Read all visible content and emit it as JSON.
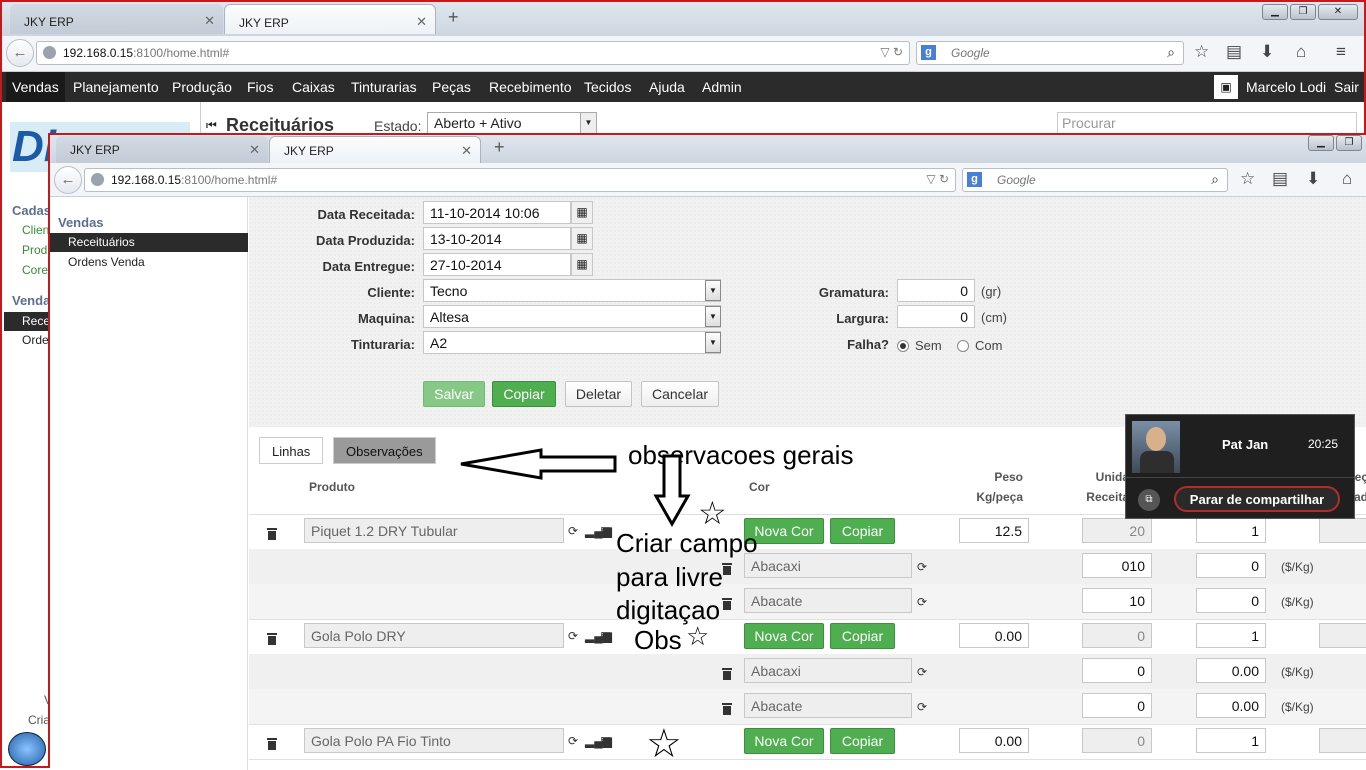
{
  "back_window": {
    "tabs": [
      {
        "title": "JKY ERP"
      },
      {
        "title": "JKY ERP"
      }
    ],
    "url_host": "192.168.0.15",
    "url_rest": ":8100/home.html#",
    "search_placeholder": "Google",
    "menu": [
      "Vendas",
      "Planejamento",
      "Produção",
      "Fios",
      "Caixas",
      "Tinturarias",
      "Peças",
      "Recebimento",
      "Tecidos",
      "Ajuda",
      "Admin"
    ],
    "user": "Marcelo Lodi",
    "logout": "Sair",
    "page_title": "Receituários",
    "estado_label": "Estado:",
    "estado_value": "Aberto + Ativo",
    "search_box_placeholder": "Procurar",
    "logo_text": "Di",
    "sidebar_partial": [
      "Cadas",
      "Clien",
      "Prod",
      "Core",
      "Venda",
      "Rece",
      "Orde",
      "V",
      "Cria"
    ]
  },
  "front_window": {
    "tabs": [
      {
        "title": "JKY ERP"
      },
      {
        "title": "JKY ERP"
      }
    ],
    "url_host": "192.168.0.15",
    "url_rest": ":8100/home.html#",
    "search_placeholder": "Google",
    "sidebar": {
      "section": "Vendas",
      "items": [
        {
          "label": "Receituários",
          "active": true
        },
        {
          "label": "Ordens Venda",
          "active": false
        }
      ]
    },
    "form": {
      "data_receitada": {
        "label": "Data Receitada:",
        "value": "11-10-2014 10:06"
      },
      "data_produzida": {
        "label": "Data Produzida:",
        "value": "13-10-2014"
      },
      "data_entregue": {
        "label": "Data Entregue:",
        "value": "27-10-2014"
      },
      "cliente": {
        "label": "Cliente:",
        "value": "Tecno"
      },
      "maquina": {
        "label": "Maquina:",
        "value": "Altesa"
      },
      "tinturaria": {
        "label": "Tinturaria:",
        "value": "A2"
      },
      "gramatura": {
        "label": "Gramatura:",
        "value": "0",
        "unit": "(gr)"
      },
      "largura": {
        "label": "Largura:",
        "value": "0",
        "unit": "(cm)"
      },
      "falha": {
        "label": "Falha?",
        "options": [
          "Sem",
          "Com"
        ],
        "selected": "Sem"
      }
    },
    "buttons": {
      "salvar": "Salvar",
      "copiar": "Copiar",
      "deletar": "Deletar",
      "cancelar": "Cancelar"
    },
    "tabs_inner": {
      "linhas": "Linhas",
      "observacoes": "Observações"
    },
    "columns": {
      "produto": "Produto",
      "cor": "Cor",
      "peso_1": "Peso",
      "peso_2": "Kg/peça",
      "unid_1": "Unida",
      "unid_2": "Receita",
      "extra_1": "eç",
      "extra_2": "ad"
    },
    "row_buttons": {
      "nova_cor": "Nova Cor",
      "copiar": "Copiar"
    },
    "per_kg": "($/Kg)",
    "products": [
      {
        "name": "Piquet 1.2 DRY Tubular",
        "peso": "12.5",
        "unid": "20",
        "qty": "1",
        "colors": [
          {
            "name": "Abacaxi",
            "a": "010",
            "b": "0"
          },
          {
            "name": "Abacate",
            "a": "10",
            "b": "0"
          }
        ]
      },
      {
        "name": "Gola Polo DRY",
        "peso": "0.00",
        "unid": "0",
        "qty": "1",
        "colors": [
          {
            "name": "Abacaxi",
            "a": "0",
            "b": "0.00"
          },
          {
            "name": "Abacate",
            "a": "0",
            "b": "0.00"
          }
        ]
      },
      {
        "name": "Gola Polo PA Fio Tinto",
        "peso": "0.00",
        "unid": "0",
        "qty": "1",
        "colors": []
      }
    ]
  },
  "annotations": {
    "observacoes": "observacoes gerais",
    "criar_1": "Criar campo",
    "criar_2": "para livre",
    "criar_3": "digitaçao",
    "criar_4": "Obs"
  },
  "share_widget": {
    "name": "Pat Jan",
    "time": "20:25",
    "stop": "Parar de compartilhar"
  }
}
